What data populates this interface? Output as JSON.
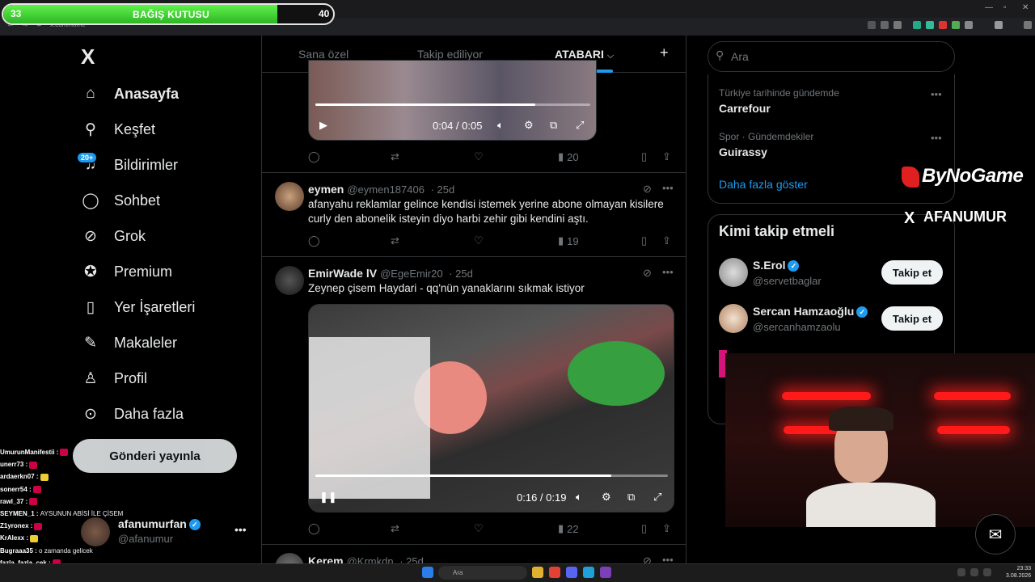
{
  "browser": {
    "url": "x.com/home"
  },
  "donation": {
    "current": "33",
    "title": "BAĞIŞ KUTUSU",
    "goal": "40",
    "progress": 0.83
  },
  "sidebar": {
    "logo": "X",
    "items": [
      {
        "label": "Anasayfa",
        "icon": "home-icon"
      },
      {
        "label": "Keşfet",
        "icon": "search-icon"
      },
      {
        "label": "Bildirimler",
        "icon": "bell-icon",
        "badge": "20+"
      },
      {
        "label": "Sohbet",
        "icon": "chat-icon"
      },
      {
        "label": "Grok",
        "icon": "grok-icon"
      },
      {
        "label": "Premium",
        "icon": "premium-icon"
      },
      {
        "label": "Yer İşaretleri",
        "icon": "bookmark-icon"
      },
      {
        "label": "Makaleler",
        "icon": "article-icon"
      },
      {
        "label": "Profil",
        "icon": "profile-icon"
      },
      {
        "label": "Daha fazla",
        "icon": "more-icon"
      }
    ],
    "post_button": "Gönderi yayınla",
    "account": {
      "name": "afanumurfan",
      "handle": "@afanumur"
    }
  },
  "chat_overlay": [
    {
      "user": "UmurunManifestii",
      "msg": ""
    },
    {
      "user": "unerr73",
      "msg": ""
    },
    {
      "user": "ardaerkn07",
      "msg": ""
    },
    {
      "user": "sonerr54",
      "msg": ""
    },
    {
      "user": "rawl_37",
      "msg": ""
    },
    {
      "user": "SEYMEN_1",
      "msg": "AYSUNUN ABİSİ İLE ÇİSEM"
    },
    {
      "user": "Z1yronex",
      "msg": ""
    },
    {
      "user": "KrAlexx",
      "msg": ""
    },
    {
      "user": "Bugraaa35",
      "msg": "o zamanda gelicek"
    },
    {
      "user": "fazla_fazla_cek",
      "msg": ""
    }
  ],
  "feed": {
    "tabs": [
      "Sana özel",
      "Takip ediliyor",
      "ATABARI"
    ],
    "active_tab": "ATABARI",
    "post1": {
      "video_time": "0:04 / 0:05",
      "video_progress": 0.8,
      "views": "20"
    },
    "post2": {
      "name": "eymen",
      "handle": "@eymen187406",
      "time": "25d",
      "text_line1": "afanyahu reklamlar gelince kendisi istemek yerine abone olmayan kisilere",
      "text_line2": "curly den abonelik isteyin diyo harbi zehir gibi kendini aştı.",
      "views": "19"
    },
    "post3": {
      "name": "EmirWade lV",
      "handle": "@EgeEmir20",
      "time": "25d",
      "text": "Zeynep çisem Haydari - qq'nün yanaklarını sıkmak istiyor",
      "video_time": "0:16 / 0:19",
      "video_progress": 0.84,
      "views": "22"
    },
    "post4": {
      "name": "Kerem",
      "handle": "@Krmkdn",
      "time": "25d"
    }
  },
  "right": {
    "search_placeholder": "Ara",
    "trends": [
      {
        "meta": "Türkiye tarihinde gündemde",
        "title": "Carrefour"
      },
      {
        "meta": "Spor · Gündemdekiler",
        "title": "Guirassy"
      }
    ],
    "show_more": "Daha fazla göster",
    "who_to_follow": {
      "title": "Kimi takip etmeli",
      "accounts": [
        {
          "name": "S.Erol",
          "handle": "@servetbaglar",
          "button": "Takip et"
        },
        {
          "name": "Sercan Hamzaoğlu",
          "handle": "@sercanhamzaolu",
          "button": "Takip et"
        }
      ]
    }
  },
  "overlay": {
    "sponsor": "ByNoGame",
    "streamer_tag": "AFANUMUR"
  },
  "taskbar": {
    "search": "Ara",
    "time": "23:33",
    "date": "3.08.2026"
  }
}
